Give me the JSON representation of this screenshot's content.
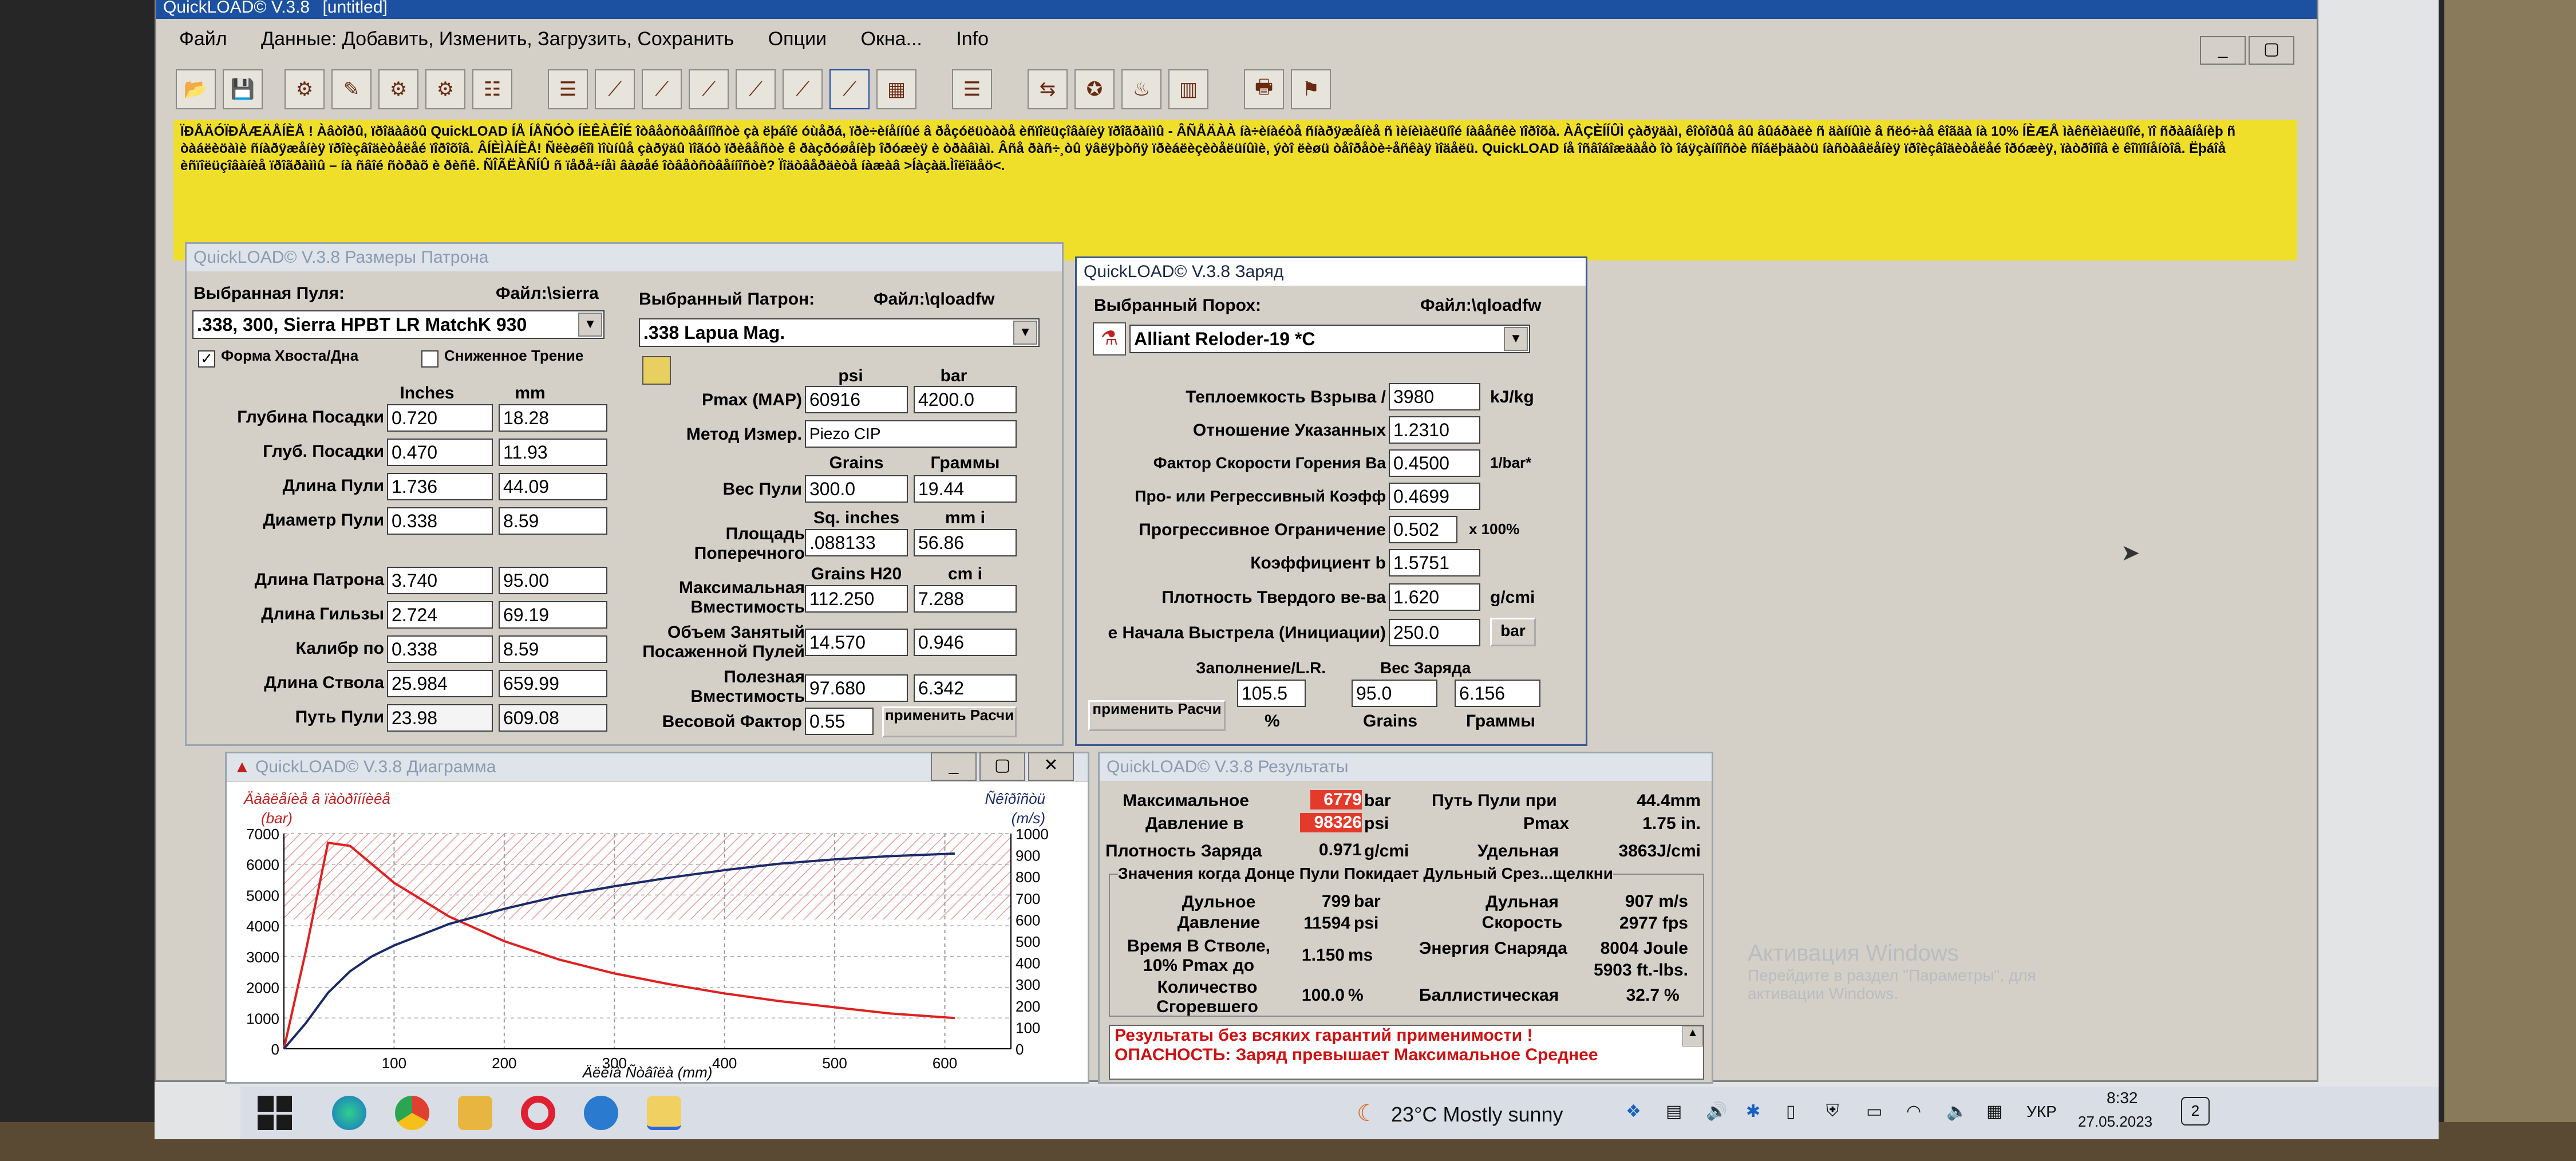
{
  "app": {
    "title": "QuickLOAD© V.3.8",
    "doc_title": "[untitled]",
    "menu": [
      "Файл",
      "Данные: Добавить, Изменить, Загрузить, Сохранить",
      "Опции",
      "Окна...",
      "Info"
    ],
    "window_buttons": [
      "_",
      "▢",
      "✕"
    ]
  },
  "toolbar": {
    "icons": [
      "open-icon",
      "save-icon",
      "bullet-icon",
      "cartridge-icon",
      "bullets-icon",
      "powder-icon",
      "calculator-icon",
      "table-icon",
      "chart-icon",
      "chart-icon",
      "chart-icon",
      "chart-icon",
      "chart-icon",
      "chart-icon",
      "grid-icon",
      "list-icon",
      "transfer-icon",
      "gun-icon",
      "fire-icon",
      "bars-icon",
      "print-icon",
      "rifle-icon"
    ],
    "glyphs": [
      "📂",
      "💾",
      "⚙",
      "✎",
      "⚙",
      "⚙",
      "☷",
      "☰",
      "⟋",
      "⟋",
      "⟋",
      "⟋",
      "⟋",
      "⟋",
      "▦",
      "☰",
      "⇆",
      "✪",
      "♨",
      "▥",
      "🖶",
      "⚑"
    ]
  },
  "warning": {
    "text": "ÏÐÅÄÓÏÐÅÆÄÅÍÈÅ ! Àâòîðû, ïðîäàâöû QuickLOAD ÍÅ ÍÅÑÓÒ ÍÈÊÀÊÎÉ îòâåòñòâåííîñòè çà ëþáîé óùåðá, ïðè÷èíåííûé â ðåçóëüòàòå èñïîëüçîâàíèÿ ïðîãðàììû - ÂÑÅÄÀÀ íà÷èíàéòå ñíàðÿæåíèå ñ ìèíèìàëüíîé íàâåñêè ïîðîõà. ÀÂÇÈÍÍÛÌ çàðÿäàì, êîòîðûå âû âûáðàëè ñ äàííûìè â ñëó÷àå êîãäà íà 10% ÍÈÆÅ ìàêñèìàëüíîé, ïî ñðàâíåíèþ ñ òàáëèöàìè ñíàðÿæåíèÿ ïðîèçâîäèòåëåé ïîðîõîâ. ÂÍÈÌÀÍÈÅ! Ñëèøêîì ìîùíûå çàðÿäû ìîãóò ïðèâåñòè ê ðàçðóøåíèþ îðóæèÿ è òðàâìàì. Âñå ðàñ÷¸òû ÿâëÿþòñÿ ïðèáëèçèòåëüíûìè, ýòî ëèøü òåîðåòè÷åñêàÿ ìîäåëü. QuickLOAD íå îñâîáîæäàåò îò îáÿçàííîñòè ñîáëþäàòü íàñòàâëåíèÿ ïðîèçâîäèòåëåé îðóæèÿ, ïàòðîíîâ è êîìïîíåíòîâ. Ëþáîå èñïîëüçîâàíèå ïðîãðàììû – íà ñâîé ñòðàõ è ðèñê. ÑÎÃËÀÑÍÛ ñ ïåðå÷íåì âàøåé îòâåòñòâåííîñòè? Ïîäòâåðäèòå íàæàâ >Íàçàä.Ìîëîäåö<."
  },
  "cartridge_panel": {
    "title": "QuickLOAD© V.3.8 Размеры Патрона",
    "bullet_label": "Выбранная Пуля:",
    "bullet_file": "Файл:\\sierra",
    "bullet_value": ".338, 300, Sierra HPBT LR MatchK 930",
    "form_label": "Форма Хвоста/Дна",
    "reduced_label": "Сниженное Трение",
    "cartridge_label": "Выбранный Патрон:",
    "cartridge_file": "Файл:\\qloadfw",
    "cartridge_value": ".338 Lapua Mag.",
    "units_inches": "Inches",
    "units_mm": "mm",
    "rows_left": [
      {
        "label": "Глубина Посадки",
        "in": "0.720",
        "mm": "18.28"
      },
      {
        "label": "Глуб. Посадки",
        "in": "0.470",
        "mm": "11.93"
      },
      {
        "label": "Длина Пули",
        "in": "1.736",
        "mm": "44.09"
      },
      {
        "label": "Диаметр Пули",
        "in": "0.338",
        "mm": "8.59"
      },
      {
        "label": "Длина Патрона",
        "in": "3.740",
        "mm": "95.00"
      },
      {
        "label": "Длина Гильзы",
        "in": "2.724",
        "mm": "69.19"
      },
      {
        "label": "Калибр по",
        "in": "0.338",
        "mm": "8.59"
      },
      {
        "label": "Длина Ствола",
        "in": "25.984",
        "mm": "659.99"
      },
      {
        "label": "Путь Пули",
        "in": "23.98",
        "mm": "609.08"
      }
    ],
    "units_psi": "psi",
    "units_bar": "bar",
    "pmax_label": "Pmax (MAP)",
    "pmax_psi": "60916",
    "pmax_bar": "4200.0",
    "method_label": "Метод Измер.",
    "method_value": "Piezo CIP",
    "units_grains": "Grains",
    "units_grams": "Граммы",
    "weight_label": "Вес Пули",
    "weight_gr": "300.0",
    "weight_g": "19.44",
    "units_sqin": "Sq. inches",
    "units_mmi": "mm i",
    "area_label": "Площадь Поперечного",
    "area_sqin": ".088133",
    "area_mm": "56.86",
    "units_grh2o": "Grains H20",
    "units_cmi": "cm i",
    "maxcap_label": "Максимальная Вместимость",
    "maxcap_gr": "112.250",
    "maxcap_cm": "7.288",
    "occupied_label": "Объем Занятый Посаженной Пулей",
    "occupied_gr": "14.570",
    "occupied_cm": "0.946",
    "usable_label": "Полезная Вместимость",
    "usable_gr": "97.680",
    "usable_cm": "6.342",
    "weightfactor_label": "Весовой Фактор",
    "weightfactor_value": "0.55",
    "apply_button": "применить Расчи"
  },
  "charge_panel": {
    "title": "QuickLOAD© V.3.8 Заряд",
    "powder_label": "Выбранный Порох:",
    "powder_file": "Файл:\\qloadfw",
    "powder_value": "Alliant Reloder-19 *C",
    "rows": [
      {
        "label": "Теплоемкость Взрыва /",
        "value": "3980",
        "unit": "kJ/kg"
      },
      {
        "label": "Отношение Указанных",
        "value": "1.2310",
        "unit": ""
      },
      {
        "label": "Фактор Скорости Горения  Ba",
        "value": "0.4500",
        "unit": "1/bar*"
      },
      {
        "label": "Про- или Регрессивный Коэфф",
        "value": "0.4699",
        "unit": ""
      },
      {
        "label": "Прогрессивное Ограничение",
        "value": "0.502",
        "unit": "x 100%"
      },
      {
        "label": "Коэффициент b",
        "value": "1.5751",
        "unit": ""
      },
      {
        "label": "Плотность Твердого ве-ва",
        "value": "1.620",
        "unit": "g/cmi"
      },
      {
        "label": "е Начала Выстрела (Инициации)",
        "value": "250.0",
        "unit": ""
      }
    ],
    "bar_button": "bar",
    "fill_label": "Заполнение/L.R.",
    "charge_label": "Вес Заряда",
    "fill_pct": "105.5",
    "charge_gr": "95.0",
    "charge_g": "6.156",
    "unit_pct": "%",
    "unit_grains": "Grains",
    "unit_grams": "Граммы",
    "apply_button": "применить Расчи"
  },
  "diagram_panel": {
    "title": "QuickLOAD© V.3.8 Диаграмма",
    "left_axis_title": "Äàâëåíèå â ïàòðîííèêå",
    "left_axis_unit": "(bar)",
    "right_axis_title": "Ñêîðîñòü",
    "right_axis_unit": "(m/s)",
    "x_axis_label": "Äëèíà Ñòâîëà (mm)"
  },
  "chart_data": {
    "type": "line",
    "title": "",
    "xlabel": "Äëèíà Ñòâîëà (mm)",
    "ylabel": "(bar)",
    "y2label": "(m/s)",
    "x": [
      0,
      20,
      40,
      60,
      80,
      100,
      150,
      200,
      250,
      300,
      350,
      400,
      450,
      500,
      550,
      609
    ],
    "series": [
      {
        "name": "",
        "axis": "left",
        "color": "#e02020",
        "values": [
          0,
          3200,
          6700,
          6600,
          6000,
          5400,
          4300,
          3500,
          2900,
          2450,
          2100,
          1800,
          1550,
          1350,
          1150,
          1000
        ]
      },
      {
        "name": "",
        "axis": "right",
        "color": "#1a2a6a",
        "values": [
          0,
          120,
          260,
          360,
          430,
          480,
          580,
          650,
          710,
          755,
          795,
          830,
          860,
          880,
          895,
          907
        ]
      }
    ],
    "xticks": [
      100,
      200,
      300,
      400,
      500,
      600
    ],
    "yticks_left": [
      0,
      1000,
      2000,
      3000,
      4000,
      5000,
      6000,
      7000
    ],
    "yticks_right": [
      0,
      100,
      200,
      300,
      400,
      500,
      600,
      700,
      800,
      900,
      1000
    ],
    "xlim": [
      0,
      660
    ],
    "ylim": [
      0,
      7000
    ],
    "y2lim": [
      0,
      1000
    ],
    "grid": true
  },
  "results_panel": {
    "title": "QuickLOAD© V.3.8 Результаты",
    "max_label": "Максимальное",
    "max_bar": "6779",
    "max_bar_unit": "bar",
    "pressure_label": "Давление в",
    "max_psi": "98326",
    "max_psi_unit": "psi",
    "travel_label": "Путь Пули при",
    "travel_pmax_label": "Pmax",
    "travel_mm": "44.4mm",
    "travel_in": "1.75 in.",
    "density_label": "Плотность Заряда",
    "density_value": "0.971",
    "density_unit": "g/cmi",
    "specific_label": "Удельная",
    "specific_value": "3863J/cmi",
    "muzzle_group": "Значения когда Донце Пули Покидает Дульный Срез...щелкни",
    "muzzle_label": "Дульное Давление",
    "muzzle_bar": "799",
    "muzzle_bar_unit": "bar",
    "muzzle_psi": "11594",
    "muzzle_psi_unit": "psi",
    "velocity_label": "Дульная Скорость",
    "velocity_ms": "907 m/s",
    "velocity_fps": "2977 fps",
    "time_label": "Время В Стволе, 10% Pmax до",
    "time_value": "1.150",
    "time_unit": "ms",
    "energy_label": "Энергия Снаряда",
    "energy_j": "8004 Joule",
    "energy_ftlbs": "5903 ft.-lbs.",
    "burnt_label": "Количество Сгоревшего",
    "burnt_value": "100.0",
    "burnt_unit": "%",
    "ballistic_label": "Баллистическая",
    "ballistic_value": "32.7",
    "ballistic_unit": "%",
    "note1": "Результаты без всяких гарантий применимости !",
    "note2": "ОПАСНОСТЬ: Заряд превышает Максимальное Среднее"
  },
  "watermark": {
    "line1": "Активация Windows",
    "line2": "Перейдите в раздел \"Параметры\", для",
    "line3": "активации Windows."
  },
  "taskbar": {
    "weather": "23°C  Mostly sunny",
    "lang": "УКР",
    "time": "8:32",
    "date": "27.05.2023",
    "notification": "2"
  }
}
